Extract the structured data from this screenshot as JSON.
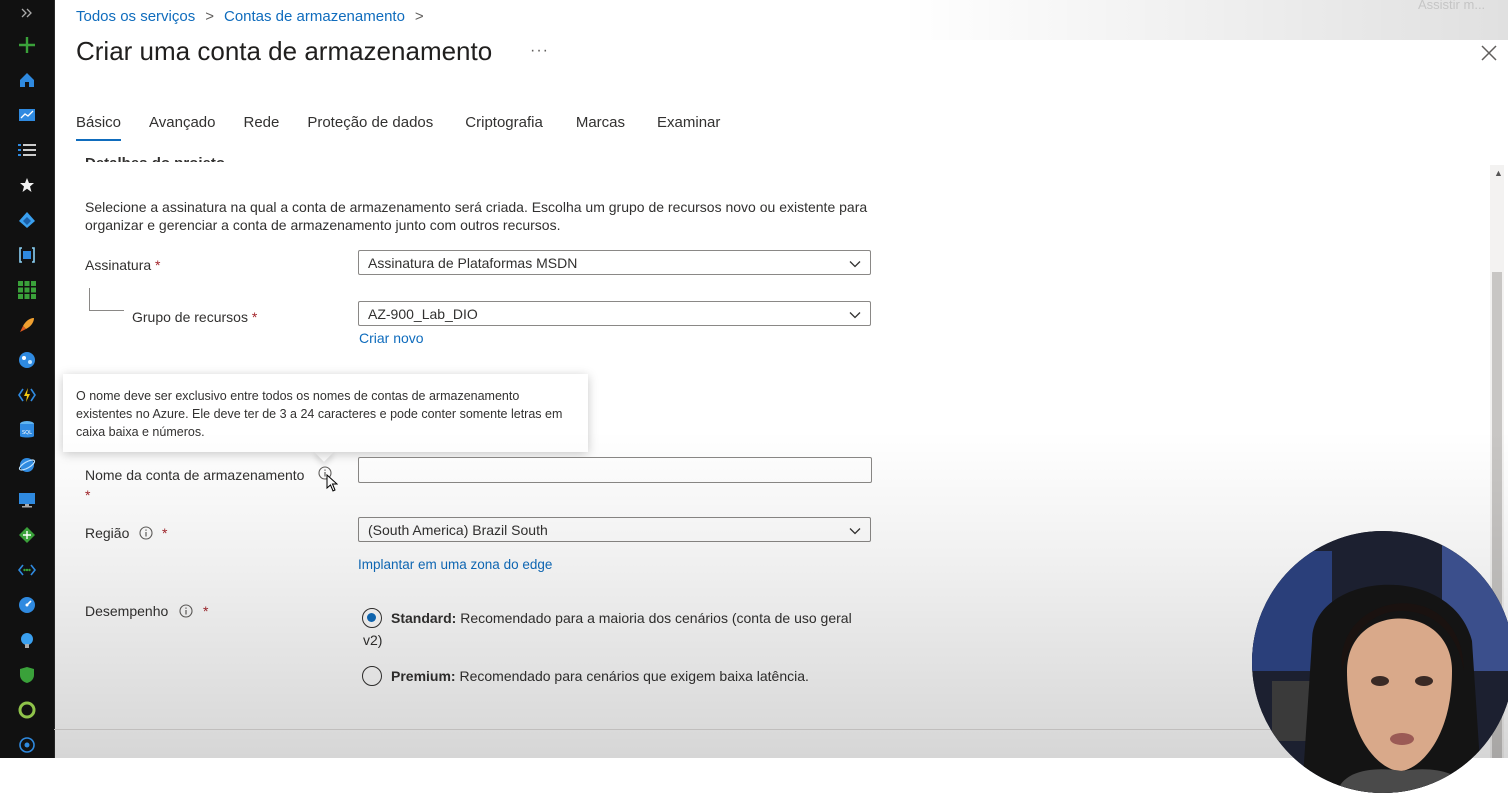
{
  "breadcrumb": {
    "items": [
      "Todos os serviços",
      "Contas de armazenamento"
    ],
    "separator": ">"
  },
  "header": {
    "title": "Criar uma conta de armazenamento",
    "more": "···",
    "watch_later": "Assistir m..."
  },
  "tabs": [
    {
      "label": "Básico",
      "active": true
    },
    {
      "label": "Avançado"
    },
    {
      "label": "Rede"
    },
    {
      "label": "Proteção de dados"
    },
    {
      "label": "Criptografia"
    },
    {
      "label": "Marcas"
    },
    {
      "label": "Examinar"
    }
  ],
  "form": {
    "section_title": "Detalhes do projeto",
    "intro": "Selecione a assinatura na qual a conta de armazenamento será criada. Escolha um grupo de recursos novo ou existente para organizar e gerenciar a conta de armazenamento junto com outros recursos.",
    "subscription": {
      "label": "Assinatura",
      "required": "*",
      "value": "Assinatura de Plataformas MSDN"
    },
    "resource_group": {
      "label": "Grupo de recursos",
      "required": "*",
      "value": "AZ-900_Lab_DIO",
      "create_new": "Criar novo"
    },
    "tooltip": "O nome deve ser exclusivo entre todos os nomes de contas de armazenamento existentes no Azure. Ele deve ter de 3 a 24 caracteres e pode conter somente letras em caixa baixa e números.",
    "storage_name": {
      "label": "Nome da conta de armazenamento",
      "required": "*",
      "value": "",
      "placeholder": ""
    },
    "region": {
      "label": "Região",
      "required": "*",
      "value": "(South America) Brazil South",
      "edge_link": "Implantar em uma zona do edge"
    },
    "performance": {
      "label": "Desempenho",
      "required": "*",
      "options": [
        {
          "bold": "Standard:",
          "text": " Recomendado para a maioria dos cenários (conta de uso geral v2)",
          "checked": true
        },
        {
          "bold": "Premium:",
          "text": " Recomendado para cenários que exigem baixa latência.",
          "checked": false
        }
      ]
    }
  },
  "colors": {
    "accent": "#0f6cbd",
    "nav_bg": "#111111",
    "required": "#a4262c"
  },
  "icons": {
    "nav": [
      "expand-icon",
      "create-resource-icon",
      "home-icon",
      "dashboard-icon",
      "all-services-icon",
      "favorites-icon",
      "azure-ad-icon",
      "resource-groups-icon",
      "all-resources-icon",
      "quickstart-icon",
      "app-services-icon",
      "function-apps-icon",
      "sql-databases-icon",
      "cosmos-db-icon",
      "virtual-machines-icon",
      "load-balancers-icon",
      "virtual-networks-icon",
      "monitor-icon",
      "advisor-icon",
      "security-center-icon",
      "cost-management-icon",
      "help-icon"
    ]
  }
}
